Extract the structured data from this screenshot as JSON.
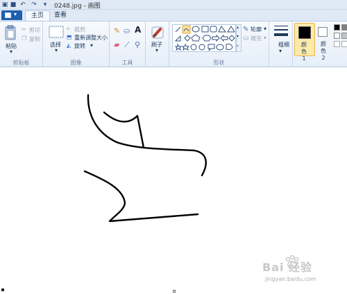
{
  "window": {
    "title": "0248.jpg - 画图"
  },
  "quick_access": [
    "save-icon",
    "undo-icon",
    "redo-icon",
    "customize-icon"
  ],
  "tabs": [
    {
      "label": "主页",
      "active": true
    },
    {
      "label": "查看",
      "active": false
    }
  ],
  "ribbon": {
    "clipboard": {
      "label": "剪贴板",
      "paste": "粘贴",
      "cut": "剪切",
      "copy": "复制"
    },
    "image": {
      "label": "图像",
      "select": "选择",
      "crop": "裁剪",
      "resize": "重新调整大小",
      "rotate": "旋转"
    },
    "tools": {
      "label": "工具"
    },
    "brushes": {
      "label": "刷子"
    },
    "shapes": {
      "label": "形状",
      "outline": "轮廓",
      "fill": "填充"
    },
    "size": {
      "label": "粗细"
    },
    "color1": {
      "label": "颜色 1",
      "value": "#000000"
    },
    "color2": {
      "label": "颜色 2",
      "value": "#ffffff"
    }
  },
  "watermark": {
    "brand": "Bai 经验",
    "site": "jingyan.baidu.com"
  }
}
